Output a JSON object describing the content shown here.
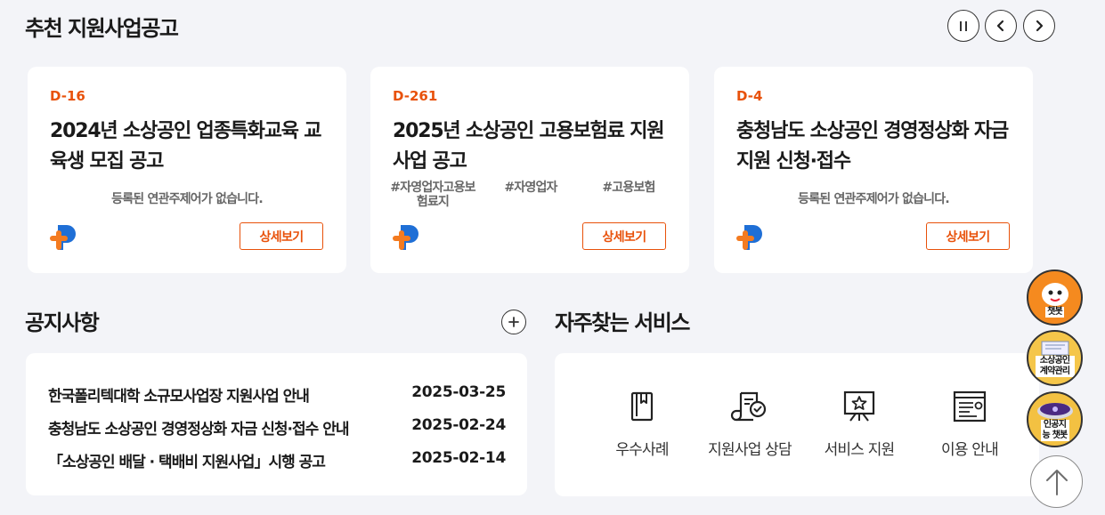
{
  "recommended": {
    "title": "추천 지원사업공고",
    "controls": {
      "pause_icon": "pause-icon",
      "prev_icon": "chevron-left-icon",
      "next_icon": "chevron-right-icon"
    },
    "detail_label": "상세보기",
    "cards": [
      {
        "dday": "D-16",
        "title": "2024년 소상공인 업종특화교육 교육생 모집 공고",
        "empty_topics": "등록된 연관주제어가 없습니다.",
        "tags": []
      },
      {
        "dday": "D-261",
        "title": "2025년 소상공인 고용보험료 지원사업 공고",
        "empty_topics": "",
        "tags": [
          "#자영업자고용보험료지",
          "#자영업자",
          "#고용보험"
        ]
      },
      {
        "dday": "D-4",
        "title": "충청남도 소상공인 경영정상화 자금 지원 신청·접수",
        "empty_topics": "등록된 연관주제어가 없습니다.",
        "tags": []
      }
    ]
  },
  "notices": {
    "title": "공지사항",
    "more_icon": "plus-icon",
    "items": [
      {
        "title": "한국폴리텍대학 소규모사업장 지원사업 안내",
        "date": "2025-03-25"
      },
      {
        "title": "충청남도 소상공인 경영정상화 자금 신청·접수 안내",
        "date": "2025-02-24"
      },
      {
        "title": "「소상공인 배달 · 택배비 지원사업」시행 공고",
        "date": "2025-02-14"
      }
    ]
  },
  "services": {
    "title": "자주찾는 서비스",
    "items": [
      {
        "label": "우수사례",
        "icon": "bookmark-book-icon"
      },
      {
        "label": "지원사업 상담",
        "icon": "document-check-icon"
      },
      {
        "label": "서비스 지원",
        "icon": "star-frame-icon"
      },
      {
        "label": "이용 안내",
        "icon": "guide-document-icon"
      }
    ]
  },
  "floating": {
    "chatbot_label": "챗봇",
    "contract_label": "소상공인 계약관리",
    "ai_chatbot_label": "인공지능 챗봇",
    "top_icon": "arrow-up-icon"
  },
  "colors": {
    "accent": "#e8510a",
    "background": "#f3f4f8",
    "card": "#ffffff",
    "logo_blue": "#1f6fd6",
    "logo_orange": "#f47b20"
  }
}
